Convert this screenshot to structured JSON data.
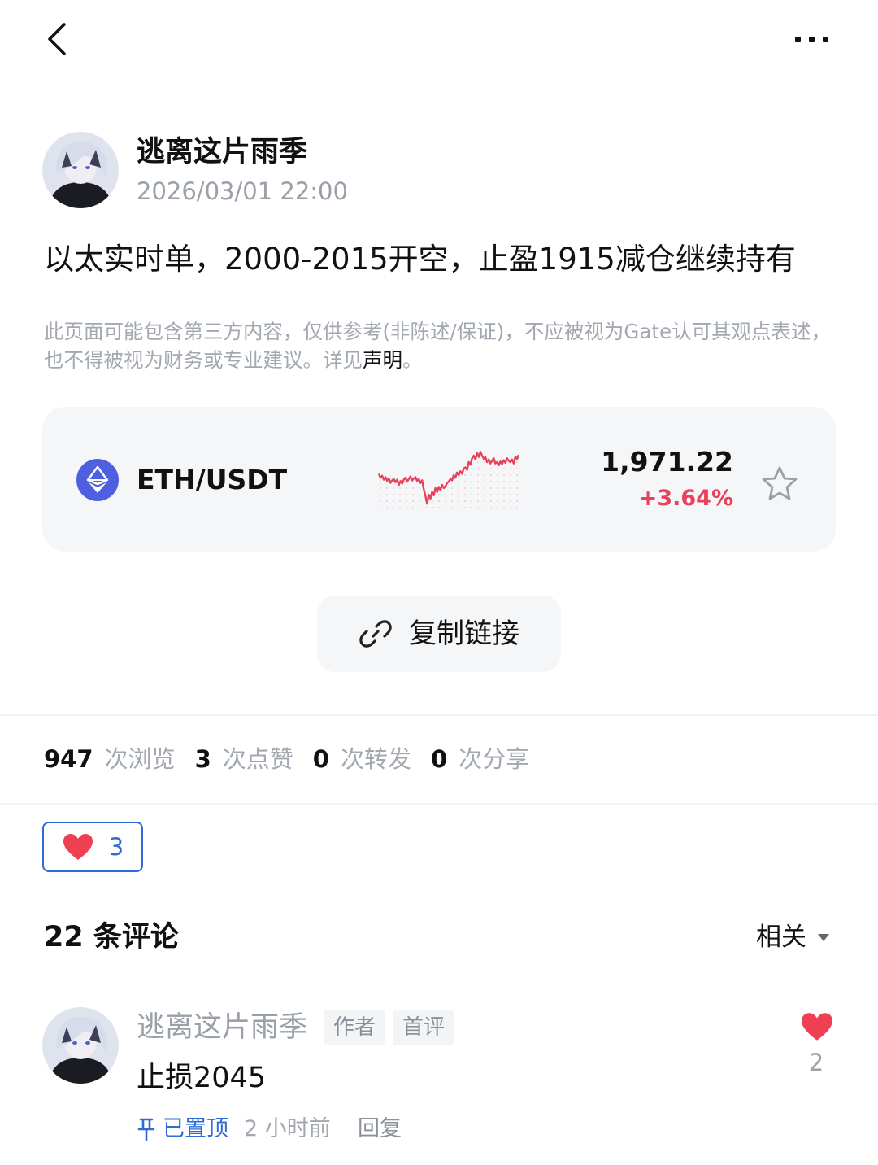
{
  "header": {
    "back_icon": "chevron-left-icon",
    "more_icon": "more-dots-icon"
  },
  "post": {
    "author": "逃离这片雨季",
    "time": "2026/03/01 22:00",
    "text": "以太实时单，2000-2015开空，止盈1915减仓继续持有"
  },
  "disclaimer": {
    "text": "此页面可能包含第三方内容，仅供参考(非陈述/保证)，不应被视为Gate认可其观点表述，也不得被视为财务或专业建议。详见",
    "link": "声明",
    "end": "。"
  },
  "ticker": {
    "pair": "ETH/USDT",
    "price": "1,971.22",
    "change": "+3.64%",
    "change_color": "#e8415b",
    "logo_color": "#4e5fe0",
    "spark": [
      0.38,
      0.44,
      0.41,
      0.47,
      0.43,
      0.49,
      0.45,
      0.52,
      0.48,
      0.46,
      0.51,
      0.47,
      0.55,
      0.49,
      0.53,
      0.47,
      0.44,
      0.5,
      0.46,
      0.42,
      0.48,
      0.45,
      0.43,
      0.49,
      0.46,
      0.52,
      0.48,
      0.62,
      0.72,
      0.84,
      0.7,
      0.76,
      0.66,
      0.71,
      0.6,
      0.66,
      0.58,
      0.63,
      0.55,
      0.6,
      0.57,
      0.52,
      0.5,
      0.46,
      0.48,
      0.4,
      0.44,
      0.36,
      0.4,
      0.34,
      0.38,
      0.3,
      0.28,
      0.32,
      0.2,
      0.24,
      0.14,
      0.1,
      0.16,
      0.06,
      0.12,
      0.04,
      0.1,
      0.15,
      0.12,
      0.2,
      0.16,
      0.22,
      0.18,
      0.14,
      0.22,
      0.2,
      0.25,
      0.19,
      0.23,
      0.17,
      0.21,
      0.14,
      0.18,
      0.2,
      0.16,
      0.22,
      0.12,
      0.15,
      0.09
    ]
  },
  "copy_link": {
    "label": "复制链接",
    "icon": "link-icon"
  },
  "stats": [
    {
      "num": "947",
      "label": "次浏览"
    },
    {
      "num": "3",
      "label": "次点赞"
    },
    {
      "num": "0",
      "label": "次转发"
    },
    {
      "num": "0",
      "label": "次分享"
    }
  ],
  "reaction": {
    "count": "3",
    "icon": "heart-icon"
  },
  "comments": {
    "title": "22 条评论",
    "sort": "相关",
    "items": [
      {
        "name": "逃离这片雨季",
        "tags": [
          "作者",
          "首评"
        ],
        "text": "止损2045",
        "likes": "2",
        "pinned": "已置顶",
        "time": "2 小时前",
        "reply": "回复"
      }
    ]
  }
}
